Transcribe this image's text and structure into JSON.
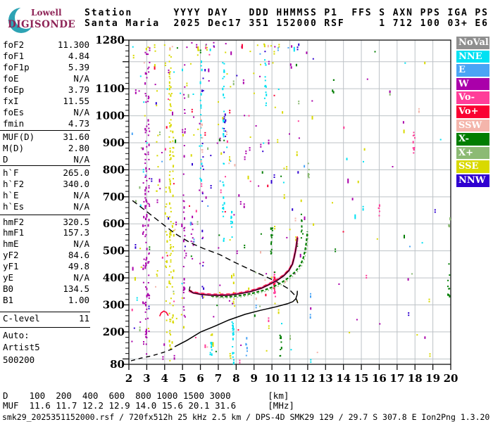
{
  "logo": {
    "line1": "Lowell",
    "line2": "DIGISONDE",
    "teal": "#2da3b4",
    "magenta": "#8e2457"
  },
  "header": {
    "line1": "Station      YYYY DAY   DDD HHMMSS P1  FFS S AXN PPS IGA PS",
    "line2": "Santa Maria  2025 Dec17 351 152000 RSF     1 712 100 03+ E6"
  },
  "left_panel": {
    "sections": [
      {
        "rows": [
          [
            "foF2",
            "11.300"
          ],
          [
            "foF1",
            "4.84"
          ],
          [
            "foF1p",
            "5.39"
          ],
          [
            "foE",
            "N/A"
          ],
          [
            "foEp",
            "3.79"
          ],
          [
            "fxI",
            "11.55"
          ],
          [
            "foEs",
            "N/A"
          ],
          [
            "fmin",
            "4.73"
          ]
        ]
      },
      {
        "rows": [
          [
            "MUF(D)",
            "31.60"
          ],
          [
            "M(D)",
            "2.80"
          ],
          [
            "D",
            "N/A"
          ]
        ]
      },
      {
        "rows": [
          [
            "h`F",
            "265.0"
          ],
          [
            "h`F2",
            "340.0"
          ],
          [
            "h`E",
            "N/A"
          ],
          [
            "h`Es",
            "N/A"
          ]
        ]
      },
      {
        "rows": [
          [
            "hmF2",
            "320.5"
          ],
          [
            "hmF1",
            "157.3"
          ],
          [
            "hmE",
            "N/A"
          ],
          [
            "yF2",
            "84.6"
          ],
          [
            "yF1",
            "49.8"
          ],
          [
            "yE",
            "N/A"
          ],
          [
            "B0",
            "134.5"
          ],
          [
            "B1",
            "1.00"
          ]
        ]
      },
      {
        "rows": [
          [
            "C-level",
            "11"
          ]
        ]
      }
    ],
    "auto_lines": [
      "Auto:",
      "Artist5",
      "500200"
    ]
  },
  "bottom": {
    "d_line": "D    100  200  400  600  800 1000 1500 3000       [km]",
    "muf_line": "MUF  11.6 11.7 12.2 12.9 14.0 15.6 20.1 31.6      [MHz]",
    "status": "smk29_2025351152000.rsf / 720fx512h 25 kHz 2.5 km / DPS-4D SMK29 129 / 29.7 S 307.8 E Ion2Png 1.3.20"
  },
  "colors": {
    "NoVal": "#8f8f8f",
    "NNE": "#00e1f2",
    "E": "#4aa4f5",
    "W": "#aa00aa",
    "Vo-": "#ff3d99",
    "Vo+": "#fa0032",
    "SSW": "#f4b5ab",
    "X-": "#007d00",
    "X+": "#8cba74",
    "SSE": "#d9d900",
    "NNW": "#2f00d0",
    "grid": "#bdc2c6",
    "axis": "#111111",
    "trace_black": "#000000"
  },
  "chart_data": {
    "type": "scatter",
    "title": "Ionogram echo plot (virtual height vs frequency)",
    "xlabel": "[MHz]",
    "ylabel": "[km]",
    "xlim": [
      2,
      20
    ],
    "ylim": [
      80,
      1280
    ],
    "grid": true,
    "x_ticks": [
      2,
      3,
      4,
      5,
      6,
      7,
      8,
      9,
      10,
      11,
      12,
      13,
      14,
      15,
      16,
      17,
      18,
      19,
      20
    ],
    "y_ticks": [
      1280,
      1100,
      1000,
      900,
      800,
      700,
      600,
      500,
      400,
      300,
      200,
      80
    ],
    "legend_position": "right-outside",
    "legend": [
      {
        "label": "NoVal",
        "color": "#8f8f8f"
      },
      {
        "label": "NNE",
        "color": "#00e1f2"
      },
      {
        "label": "E",
        "color": "#4aa4f5"
      },
      {
        "label": "W",
        "color": "#aa00aa"
      },
      {
        "label": "Vo-",
        "color": "#ff3d99"
      },
      {
        "label": "Vo+",
        "color": "#fa0032"
      },
      {
        "label": "SSW",
        "color": "#f4b5ab"
      },
      {
        "label": "X-",
        "color": "#007d00"
      },
      {
        "label": "X+",
        "color": "#8cba74"
      },
      {
        "label": "SSE",
        "color": "#d9d900"
      },
      {
        "label": "NNW",
        "color": "#2f00d0"
      }
    ],
    "muf_table": {
      "d_km": [
        100,
        200,
        400,
        600,
        800,
        1000,
        1500,
        3000
      ],
      "muf_mhz": [
        11.6,
        11.7,
        12.2,
        12.9,
        14.0,
        15.6,
        20.1,
        31.6
      ]
    },
    "series": [
      {
        "name": "transmission-curve",
        "style": "dashed-black",
        "points": [
          [
            2.2,
            686
          ],
          [
            3.0,
            645
          ],
          [
            3.85,
            601
          ],
          [
            4.6,
            563
          ],
          [
            5.43,
            530
          ],
          [
            6.2,
            508
          ],
          [
            7.08,
            486
          ],
          [
            7.9,
            458
          ],
          [
            8.77,
            431
          ],
          [
            9.5,
            409
          ],
          [
            10.23,
            387
          ],
          [
            10.94,
            359
          ],
          [
            11.29,
            335
          ],
          [
            11.45,
            306
          ]
        ]
      },
      {
        "name": "profile-extrapolated",
        "style": "dashed-black",
        "points": [
          [
            2.12,
            93
          ],
          [
            2.67,
            103
          ],
          [
            3.26,
            111
          ],
          [
            3.93,
            124
          ],
          [
            4.44,
            137
          ]
        ]
      },
      {
        "name": "true-height-profile",
        "style": "solid-black",
        "points": [
          [
            4.56,
            145
          ],
          [
            5.23,
            168
          ],
          [
            6.02,
            200
          ],
          [
            6.8,
            221
          ],
          [
            7.59,
            244
          ],
          [
            8.5,
            265
          ],
          [
            9.36,
            280
          ],
          [
            10.23,
            293
          ],
          [
            10.86,
            304
          ],
          [
            11.17,
            312
          ],
          [
            11.33,
            322
          ],
          [
            11.41,
            338
          ],
          [
            11.42,
            352
          ]
        ]
      },
      {
        "name": "o-mode-trace",
        "style": "pink",
        "points": [
          [
            5.35,
            352
          ],
          [
            5.6,
            345
          ],
          [
            6.0,
            340
          ],
          [
            6.5,
            337
          ],
          [
            7.0,
            336
          ],
          [
            7.6,
            337
          ],
          [
            8.2,
            342
          ],
          [
            8.8,
            350
          ],
          [
            9.4,
            362
          ],
          [
            9.9,
            378
          ],
          [
            10.3,
            392
          ],
          [
            10.65,
            408
          ],
          [
            10.95,
            428
          ],
          [
            11.15,
            452
          ],
          [
            11.25,
            478
          ],
          [
            11.33,
            505
          ],
          [
            11.4,
            535
          ],
          [
            11.43,
            550
          ]
        ]
      },
      {
        "name": "artist-scaled-trace",
        "style": "solid-black",
        "points": [
          [
            5.42,
            368
          ],
          [
            5.37,
            354
          ],
          [
            5.6,
            344
          ],
          [
            6.0,
            339
          ],
          [
            6.5,
            336
          ],
          [
            7.0,
            335
          ],
          [
            7.6,
            336
          ],
          [
            8.2,
            341
          ],
          [
            8.8,
            349
          ],
          [
            9.4,
            361
          ],
          [
            9.9,
            377
          ],
          [
            10.3,
            391
          ],
          [
            10.65,
            407
          ],
          [
            10.95,
            427
          ],
          [
            11.15,
            451
          ],
          [
            11.25,
            477
          ],
          [
            11.33,
            504
          ],
          [
            11.39,
            530
          ],
          [
            11.42,
            548
          ]
        ]
      },
      {
        "name": "x-mode-trace",
        "style": "green",
        "points": [
          [
            6.6,
            333
          ],
          [
            7.1,
            331
          ],
          [
            7.7,
            331
          ],
          [
            8.3,
            335
          ],
          [
            8.9,
            343
          ],
          [
            9.5,
            353
          ],
          [
            10.0,
            365
          ],
          [
            10.5,
            381
          ],
          [
            10.9,
            399
          ],
          [
            11.3,
            422
          ],
          [
            11.6,
            448
          ],
          [
            11.75,
            472
          ],
          [
            11.85,
            500
          ],
          [
            11.92,
            530
          ],
          [
            11.96,
            555
          ],
          [
            11.98,
            572
          ]
        ]
      },
      {
        "name": "es-artifact",
        "style": "red",
        "points": [
          [
            3.72,
            258
          ],
          [
            3.8,
            270
          ],
          [
            3.95,
            277
          ],
          [
            4.1,
            272
          ],
          [
            4.2,
            260
          ]
        ]
      }
    ],
    "noise_columns": [
      [
        2.92,
        "W",
        100,
        1255,
        70
      ],
      [
        3.07,
        "W",
        130,
        1250,
        40
      ],
      [
        2.78,
        "W",
        300,
        900,
        16
      ],
      [
        4.27,
        "SSE",
        95,
        1255,
        80
      ],
      [
        4.43,
        "SSE",
        150,
        1000,
        30
      ],
      [
        4.06,
        "SSE",
        200,
        800,
        18
      ],
      [
        3.55,
        "SSE",
        400,
        1100,
        12
      ],
      [
        5.06,
        "W",
        250,
        1230,
        38
      ],
      [
        5.5,
        "W",
        530,
        640,
        7
      ],
      [
        6.0,
        "NNE",
        700,
        1210,
        22
      ],
      [
        6.1,
        "NNW",
        320,
        1160,
        16
      ],
      [
        6.03,
        "SSW",
        820,
        1010,
        9
      ],
      [
        6.55,
        "NNE",
        115,
        175,
        8
      ],
      [
        7.25,
        "NNE",
        620,
        1225,
        32
      ],
      [
        7.32,
        "NNW",
        860,
        1010,
        10
      ],
      [
        7.78,
        "NNE",
        85,
        245,
        22
      ],
      [
        7.7,
        "NNE",
        530,
        660,
        10
      ],
      [
        7.85,
        "SSE",
        260,
        420,
        8
      ],
      [
        8.55,
        "E",
        90,
        200,
        6
      ],
      [
        9.6,
        "NNE",
        1040,
        1210,
        14
      ],
      [
        9.95,
        "X-",
        490,
        600,
        13
      ],
      [
        10.1,
        "Vo-",
        330,
        430,
        22
      ],
      [
        10.12,
        "Vo+",
        350,
        410,
        8
      ],
      [
        10.45,
        "X-",
        100,
        195,
        11
      ],
      [
        11.65,
        "X-",
        545,
        655,
        9
      ],
      [
        12.0,
        "X+",
        740,
        840,
        7
      ],
      [
        17.9,
        "Vo-",
        855,
        960,
        11
      ],
      [
        19.85,
        "X-",
        330,
        500,
        10
      ],
      [
        19.9,
        "X+",
        560,
        640,
        5
      ],
      [
        15.95,
        "Vo-",
        630,
        700,
        5
      ],
      [
        13.4,
        "X-",
        1080,
        1140,
        4
      ]
    ],
    "noise_general": {
      "seed": 987654,
      "regions": [
        {
          "f1": 2.05,
          "f2": 9.8,
          "h1": 85,
          "h2": 1270,
          "n": 230
        },
        {
          "f1": 9.8,
          "f2": 12.2,
          "h1": 85,
          "h2": 1270,
          "n": 50
        },
        {
          "f1": 12.2,
          "f2": 19.9,
          "h1": 85,
          "h2": 1270,
          "n": 45
        },
        {
          "f1": 2.1,
          "f2": 11.5,
          "h1": 1250,
          "h2": 1274,
          "n": 32
        }
      ],
      "color_weights": [
        [
          "W",
          26
        ],
        [
          "SSE",
          24
        ],
        [
          "NNE",
          10
        ],
        [
          "Vo-",
          8
        ],
        [
          "NNW",
          7
        ],
        [
          "X-",
          7
        ],
        [
          "E",
          5
        ],
        [
          "SSW",
          5
        ],
        [
          "Vo+",
          4
        ],
        [
          "X+",
          4
        ]
      ]
    }
  }
}
